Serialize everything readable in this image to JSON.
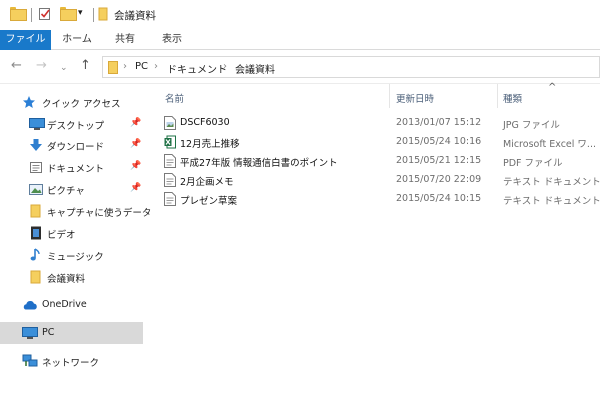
{
  "window": {
    "title": "会議資料"
  },
  "ribbon": {
    "tabs": [
      "ファイル",
      "ホーム",
      "共有",
      "表示"
    ]
  },
  "address": {
    "segments": [
      "PC",
      "ドキュメント",
      "会議資料"
    ],
    "separator": "›"
  },
  "sidebar": {
    "quick_access": "クイック アクセス",
    "items": [
      {
        "label": "デスクトップ",
        "icon": "desktop-icon",
        "pinned": true
      },
      {
        "label": "ダウンロード",
        "icon": "download-icon",
        "pinned": true
      },
      {
        "label": "ドキュメント",
        "icon": "documents-icon",
        "pinned": true
      },
      {
        "label": "ピクチャ",
        "icon": "pictures-icon",
        "pinned": true
      },
      {
        "label": "キャプチャに使うデータ",
        "icon": "folder-icon",
        "pinned": false
      },
      {
        "label": "ビデオ",
        "icon": "video-icon",
        "pinned": false
      },
      {
        "label": "ミュージック",
        "icon": "music-icon",
        "pinned": false
      },
      {
        "label": "会議資料",
        "icon": "folder-icon",
        "pinned": false
      }
    ],
    "onedrive": "OneDrive",
    "pc": "PC",
    "network": "ネットワーク"
  },
  "columns": {
    "name": "名前",
    "date": "更新日時",
    "type": "種類"
  },
  "files": [
    {
      "name": "DSCF6030",
      "date": "2013/01/07 15:12",
      "type": "JPG ファイル",
      "icon": "image-file-icon"
    },
    {
      "name": "12月売上推移",
      "date": "2015/05/24 10:16",
      "type": "Microsoft Excel ワ...",
      "icon": "excel-file-icon"
    },
    {
      "name": "平成27年版 情報通信白書のポイント",
      "date": "2015/05/21 12:15",
      "type": "PDF ファイル",
      "icon": "pdf-file-icon"
    },
    {
      "name": "2月企画メモ",
      "date": "2015/07/20 22:09",
      "type": "テキスト ドキュメント",
      "icon": "text-file-icon"
    },
    {
      "name": "プレゼン草案",
      "date": "2015/05/24 10:15",
      "type": "テキスト ドキュメント",
      "icon": "text-file-icon"
    }
  ],
  "colors": {
    "accent": "#1979ca",
    "selected_row": "#d9d9d9",
    "header_text": "#4c607a"
  }
}
